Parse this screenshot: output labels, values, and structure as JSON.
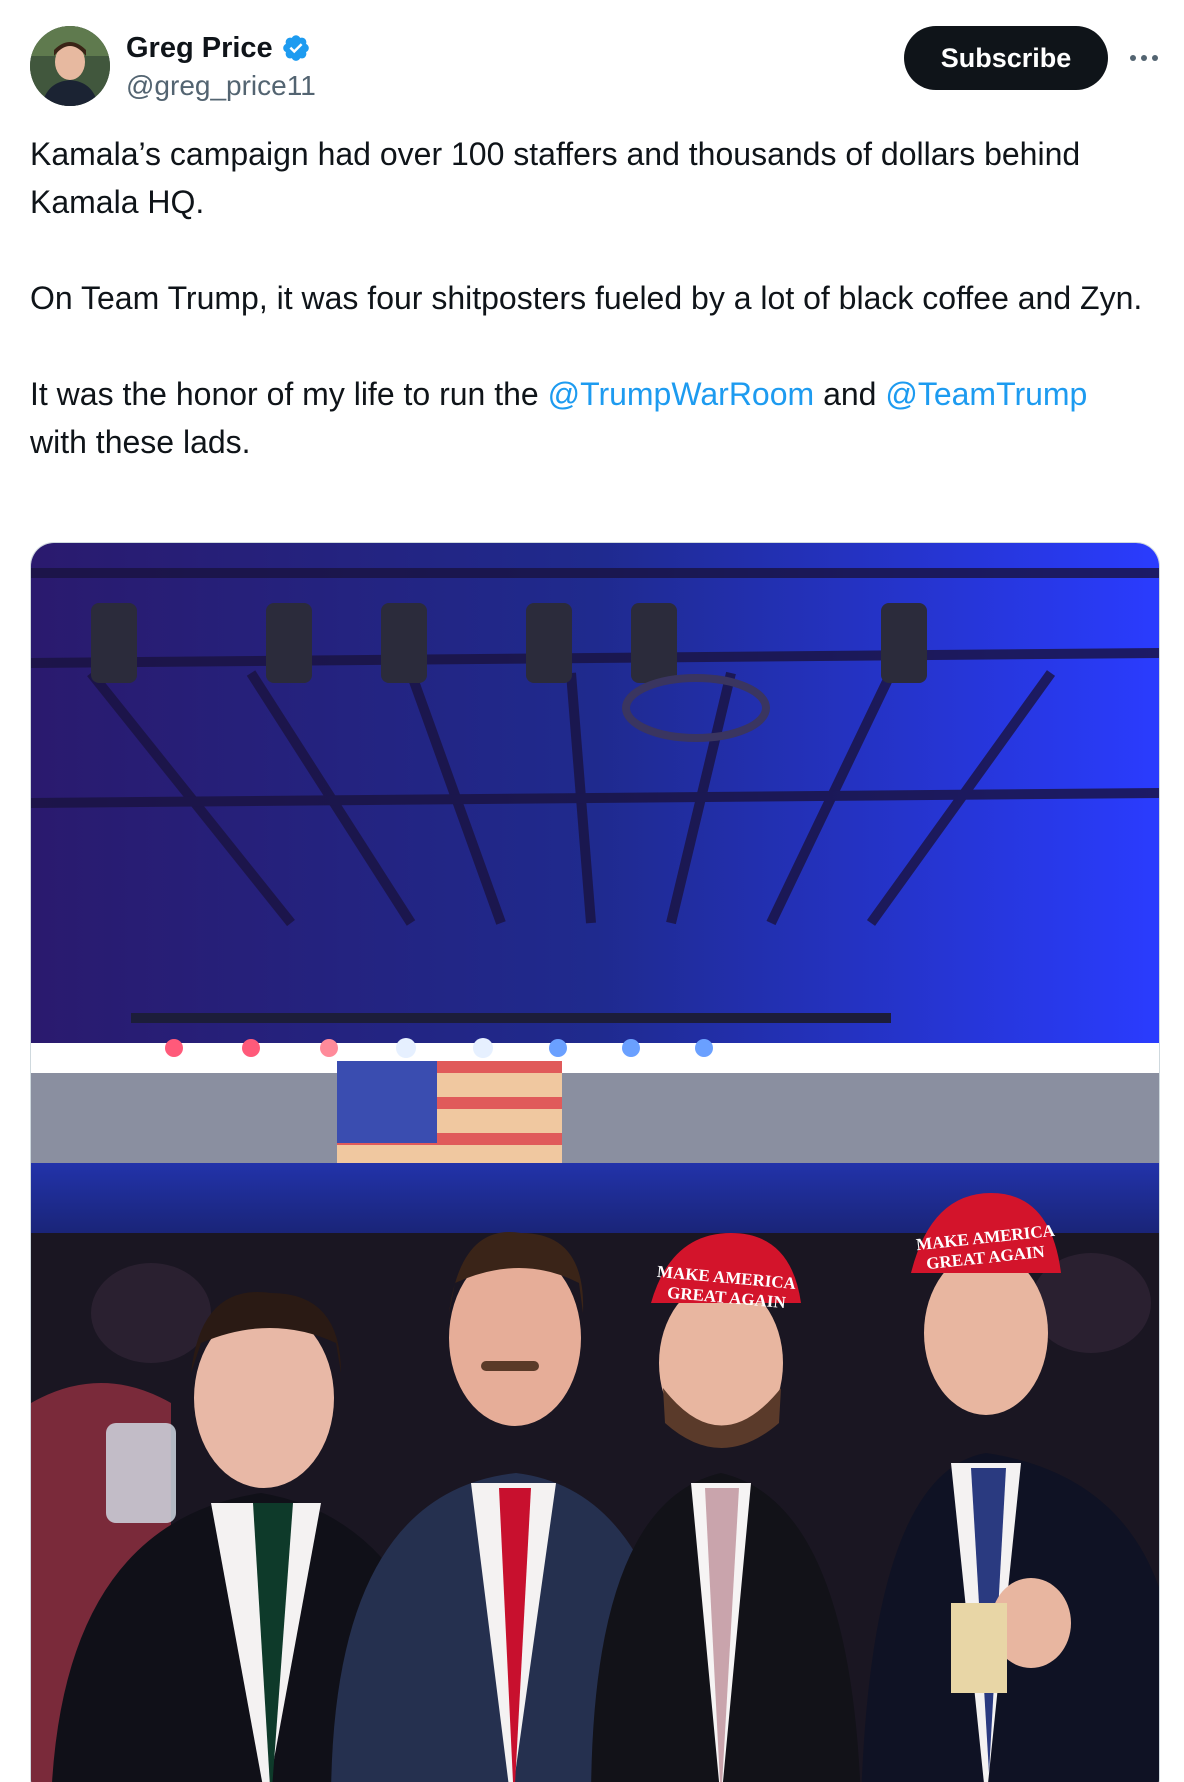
{
  "author": {
    "display_name": "Greg Price",
    "handle": "@greg_price11",
    "verified": true,
    "avatar_icon": "profile-photo"
  },
  "actions": {
    "subscribe_label": "Subscribe",
    "more_icon": "ellipsis-icon"
  },
  "tweet": {
    "line1": "Kamala’s campaign had over 100 staffers and thousands of dollars behind Kamala HQ.",
    "line2": "On Team Trump, it was four shitposters fueled by a lot of black coffee and Zyn.",
    "line3_prefix": "It was the honor of my life to run the ",
    "mention1": "@TrumpWarRoom",
    "line3_mid": " and ",
    "mention2": "@TeamTrump",
    "line3_suffix": " with these lads."
  },
  "media": {
    "hat_text_line1": "MAKE AMERICA",
    "hat_text_line2": "GREAT AGAIN"
  },
  "colors": {
    "accent": "#1d9bf0",
    "verified": "#1d9bf0",
    "button_bg": "#0f1419"
  }
}
